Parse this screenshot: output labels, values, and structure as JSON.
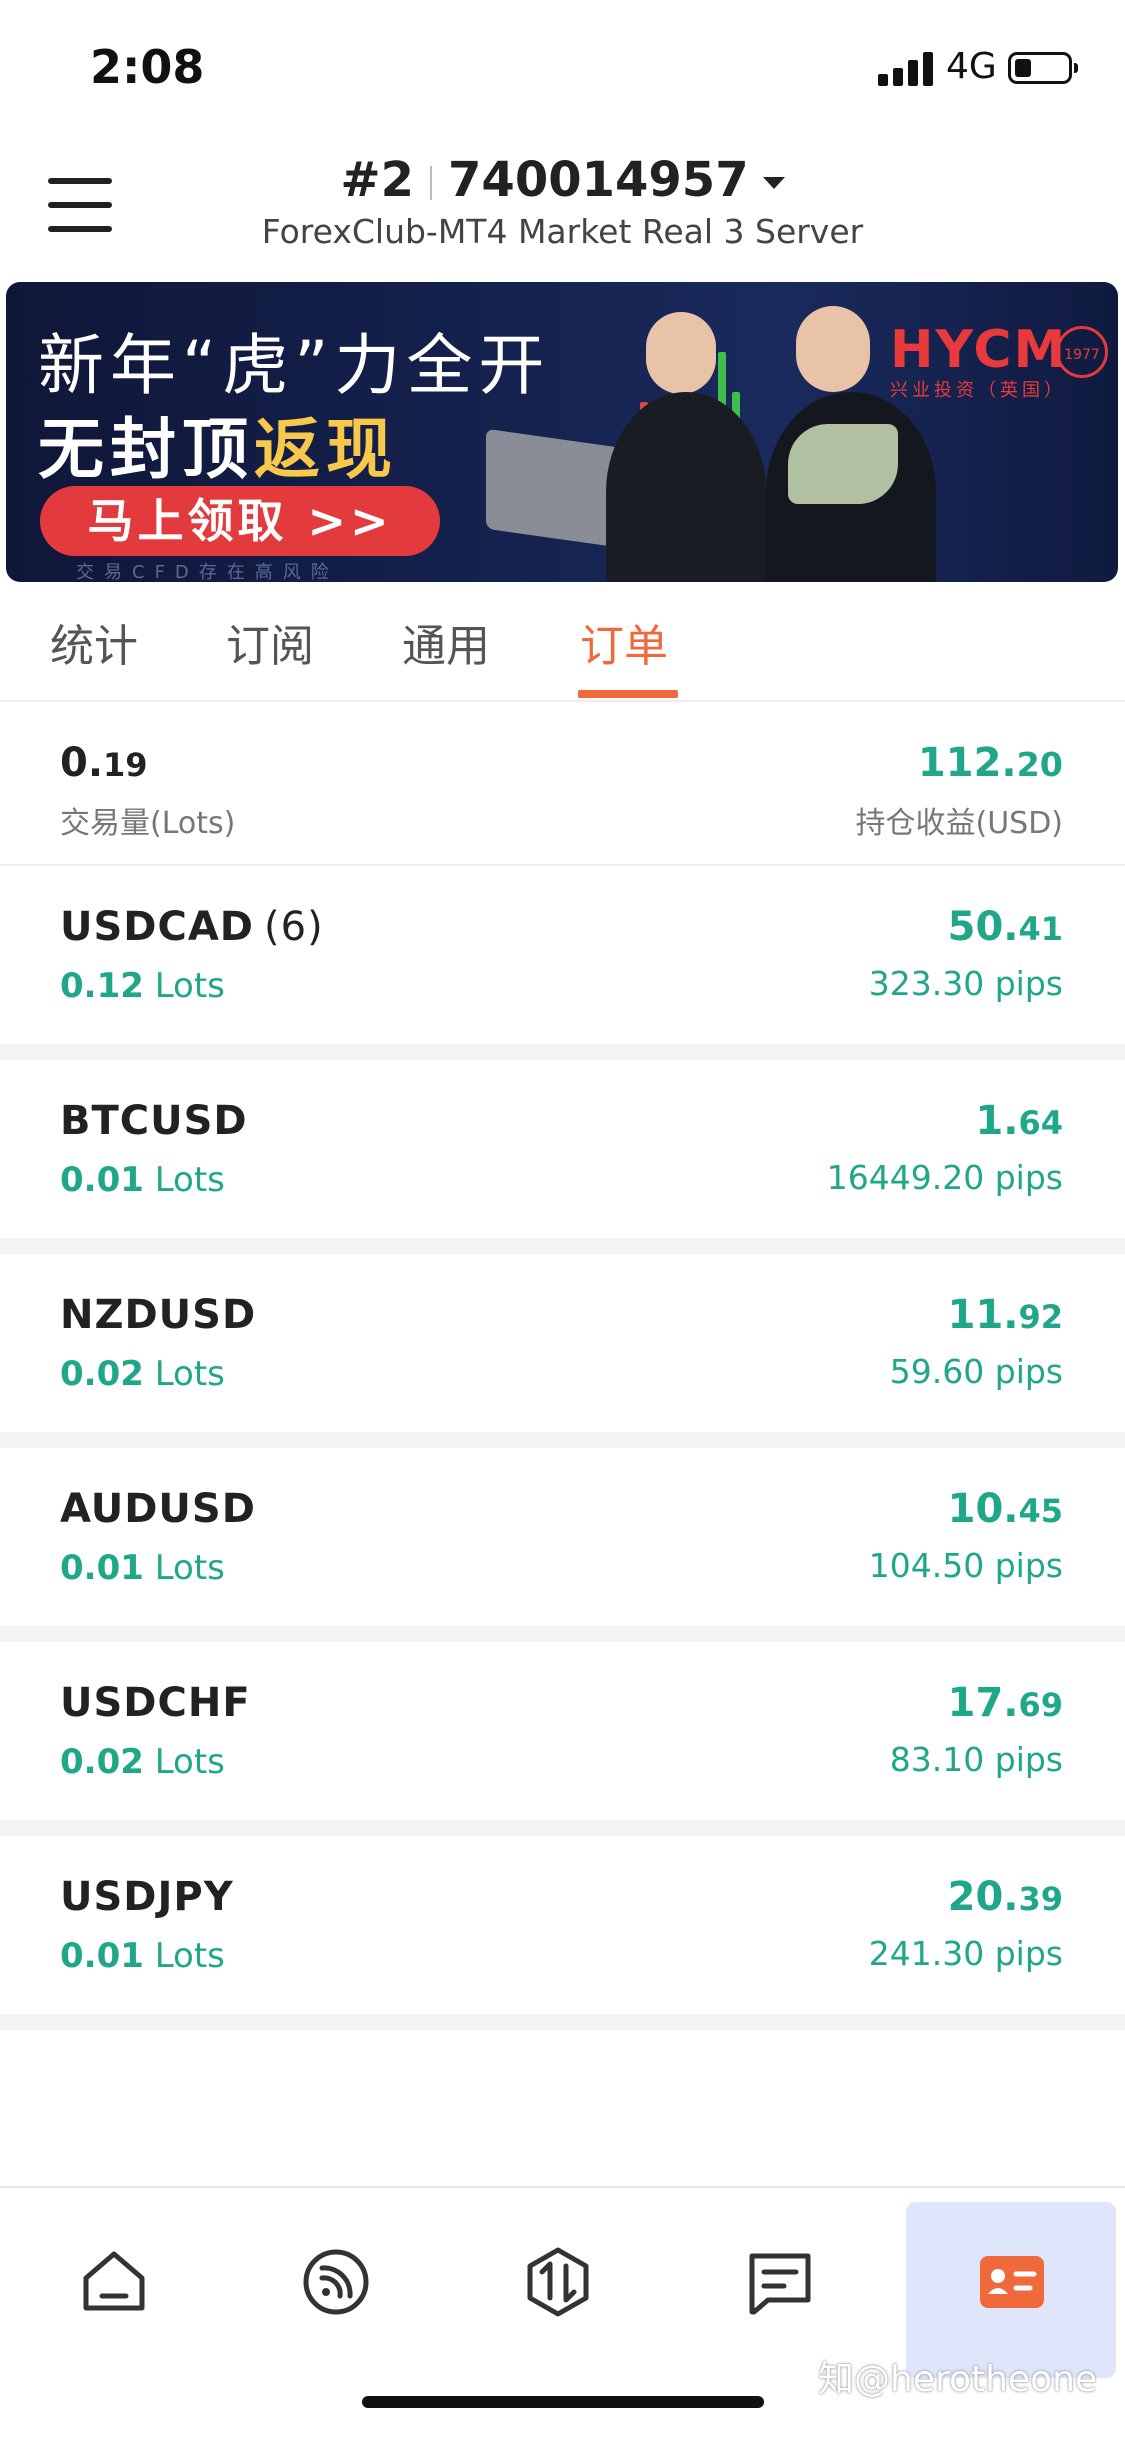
{
  "status_bar": {
    "time": "2:08",
    "network": "4G"
  },
  "header": {
    "account_prefix": "#2",
    "account_number": "740014957",
    "server": "ForexClub-MT4 Market Real 3 Server"
  },
  "banner": {
    "line1": "新年“虎”力全开",
    "line2_prefix": "无封顶",
    "line2_highlight": "返现",
    "cta": "马上领取 >>",
    "risk_notice": "交易CFD存在高风险",
    "brand": "HYCM",
    "brand_sub": "兴业投资（英国）",
    "seal_text": "1977"
  },
  "tabs": [
    {
      "label": "统计"
    },
    {
      "label": "订阅"
    },
    {
      "label": "通用"
    },
    {
      "label": "订单"
    }
  ],
  "active_tab": "订单",
  "summary": {
    "volume_main": "0.",
    "volume_small": "19",
    "volume_label": "交易量(Lots)",
    "profit_main": "112.",
    "profit_small": "20",
    "profit_label": "持仓收益(USD)"
  },
  "orders": [
    {
      "symbol": "USDCAD",
      "count": "(6)",
      "lots_value": "0.12",
      "lots_unit": "Lots",
      "profit_main": "50.",
      "profit_small": "41",
      "pips": "323.30 pips"
    },
    {
      "symbol": "BTCUSD",
      "count": "",
      "lots_value": "0.01",
      "lots_unit": "Lots",
      "profit_main": "1.",
      "profit_small": "64",
      "pips": "16449.20 pips"
    },
    {
      "symbol": "NZDUSD",
      "count": "",
      "lots_value": "0.02",
      "lots_unit": "Lots",
      "profit_main": "11.",
      "profit_small": "92",
      "pips": "59.60 pips"
    },
    {
      "symbol": "AUDUSD",
      "count": "",
      "lots_value": "0.01",
      "lots_unit": "Lots",
      "profit_main": "10.",
      "profit_small": "45",
      "pips": "104.50 pips"
    },
    {
      "symbol": "USDCHF",
      "count": "",
      "lots_value": "0.02",
      "lots_unit": "Lots",
      "profit_main": "17.",
      "profit_small": "69",
      "pips": "83.10 pips"
    },
    {
      "symbol": "USDJPY",
      "count": "",
      "lots_value": "0.01",
      "lots_unit": "Lots",
      "profit_main": "20.",
      "profit_small": "39",
      "pips": "241.30 pips"
    }
  ],
  "bottom_nav": [
    {
      "icon": "home-icon"
    },
    {
      "icon": "signal-feed-icon"
    },
    {
      "icon": "trade-icon"
    },
    {
      "icon": "message-icon"
    },
    {
      "icon": "account-card-icon"
    }
  ],
  "watermark": "知@herotheone",
  "colors": {
    "accent_orange": "#f0693a",
    "profit_green": "#20a78a",
    "active_nav_bg": "#dfe6fb",
    "banner_red": "#e23a3d"
  }
}
